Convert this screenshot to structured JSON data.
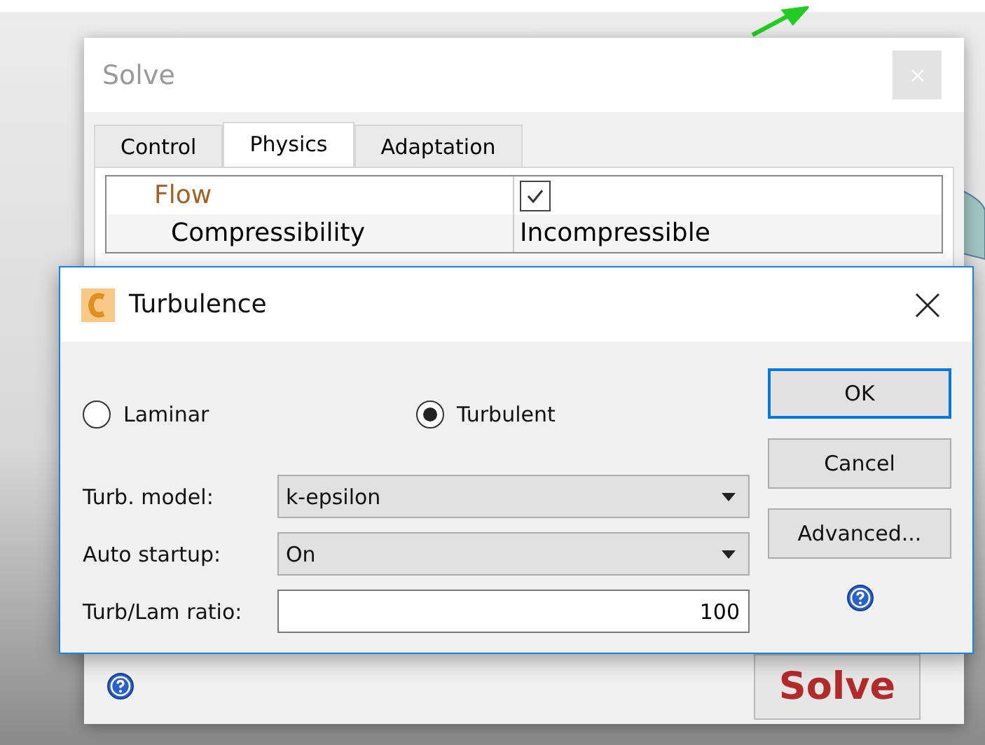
{
  "solve_window": {
    "title": "Solve",
    "tabs": [
      {
        "label": "Control",
        "selected": false
      },
      {
        "label": "Physics",
        "selected": true
      },
      {
        "label": "Adaptation",
        "selected": false
      }
    ],
    "properties": [
      {
        "kind": "group",
        "name": "Flow",
        "checked": true
      },
      {
        "kind": "value",
        "name": "Compressibility",
        "value": "Incompressible"
      }
    ],
    "solve_button": "Solve"
  },
  "turbulence_dialog": {
    "title": "Turbulence",
    "flow_options": [
      {
        "label": "Laminar",
        "selected": false
      },
      {
        "label": "Turbulent",
        "selected": true
      }
    ],
    "fields": [
      {
        "kind": "dropdown",
        "label": "Turb. model:",
        "value": "k-epsilon"
      },
      {
        "kind": "dropdown",
        "label": "Auto startup:",
        "value": "On"
      },
      {
        "kind": "text",
        "label": "Turb/Lam ratio:",
        "value": "100"
      }
    ],
    "buttons": [
      {
        "label": "OK",
        "default": true
      },
      {
        "label": "Cancel",
        "default": false
      },
      {
        "label": "Advanced...",
        "default": false
      }
    ]
  }
}
